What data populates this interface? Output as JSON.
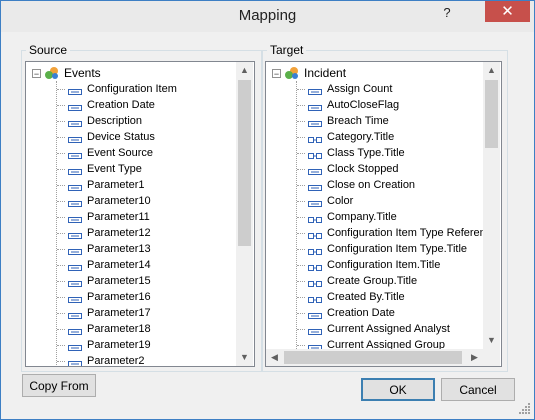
{
  "window": {
    "title": "Mapping",
    "help": "?",
    "close": "✕"
  },
  "source": {
    "label": "Source",
    "root": "Events",
    "items": [
      "Configuration Item",
      "Creation Date",
      "Description",
      "Device Status",
      "Event Source",
      "Event Type",
      "Parameter1",
      "Parameter10",
      "Parameter11",
      "Parameter12",
      "Parameter13",
      "Parameter14",
      "Parameter15",
      "Parameter16",
      "Parameter17",
      "Parameter18",
      "Parameter19",
      "Parameter2"
    ]
  },
  "target": {
    "label": "Target",
    "root": "Incident",
    "items": [
      {
        "label": "Assign Count",
        "kind": "simple"
      },
      {
        "label": "AutoCloseFlag",
        "kind": "simple"
      },
      {
        "label": "Breach Time",
        "kind": "simple"
      },
      {
        "label": "Category.Title",
        "kind": "relation"
      },
      {
        "label": "Class Type.Title",
        "kind": "relation"
      },
      {
        "label": "Clock Stopped",
        "kind": "simple"
      },
      {
        "label": "Close on Creation",
        "kind": "simple"
      },
      {
        "label": "Color",
        "kind": "simple"
      },
      {
        "label": "Company.Title",
        "kind": "relation"
      },
      {
        "label": "Configuration Item Type Reference",
        "kind": "relation"
      },
      {
        "label": "Configuration Item Type.Title",
        "kind": "relation"
      },
      {
        "label": "Configuration Item.Title",
        "kind": "relation"
      },
      {
        "label": "Create Group.Title",
        "kind": "relation"
      },
      {
        "label": "Created By.Title",
        "kind": "relation"
      },
      {
        "label": "Creation Date",
        "kind": "simple"
      },
      {
        "label": "Current Assigned Analyst",
        "kind": "simple"
      },
      {
        "label": "Current Assigned Group",
        "kind": "simple"
      }
    ]
  },
  "buttons": {
    "copy_from": "Copy From",
    "ok": "OK",
    "cancel": "Cancel"
  },
  "colors": {
    "accent": "#3c7fb1",
    "close": "#c7504b",
    "tree_line": "#a0a0a0"
  }
}
